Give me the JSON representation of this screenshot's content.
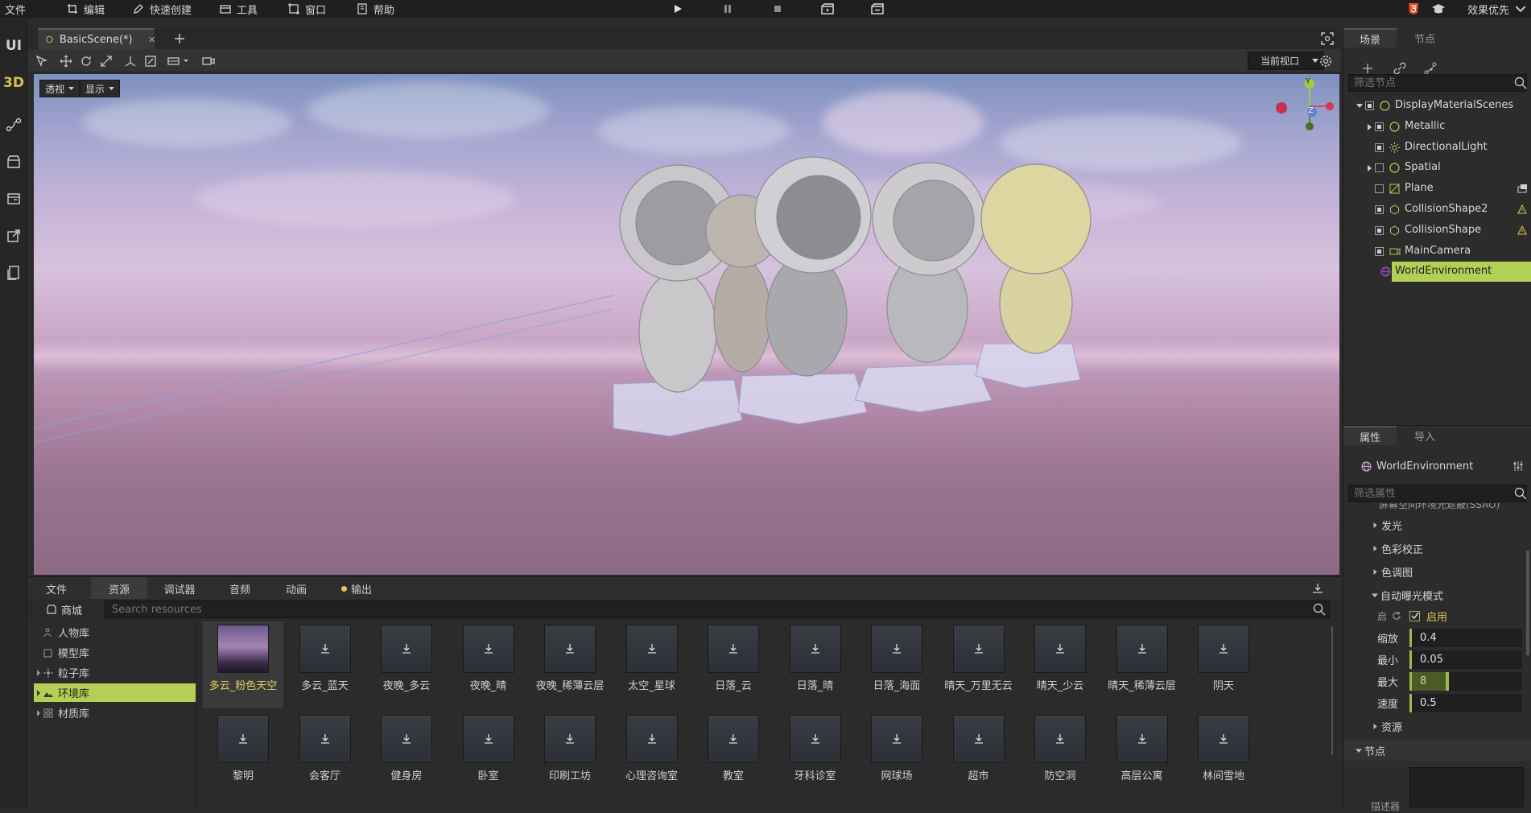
{
  "menu": {
    "file": "文件",
    "edit": "编辑",
    "quick_create": "快速创建",
    "tools": "工具",
    "window": "窗口",
    "help": "帮助",
    "effect_priority": "效果优先"
  },
  "left_rail": {
    "ui": "UI",
    "threed": "3D"
  },
  "doc_tab": {
    "title": "BasicScene(*)"
  },
  "viewport": {
    "view_select": "当前视口",
    "perspective": "透视",
    "display": "显示",
    "gizmo": {
      "y": "Y",
      "z": "Z"
    }
  },
  "bottom": {
    "tabs": [
      "文件",
      "资源",
      "调试器",
      "音频",
      "动画",
      "输出"
    ],
    "store": "商城",
    "search_placeholder": "Search resources",
    "tree": [
      {
        "label": "人物库"
      },
      {
        "label": "模型库"
      },
      {
        "label": "粒子库"
      },
      {
        "label": "环境库"
      },
      {
        "label": "材质库"
      }
    ],
    "row1": [
      "多云_粉色天空",
      "多云_蓝天",
      "夜晚_多云",
      "夜晚_晴",
      "夜晚_稀薄云层",
      "太空_星球",
      "日落_云",
      "日落_晴",
      "日落_海面",
      "晴天_万里无云",
      "晴天_少云",
      "晴天_稀薄云层",
      "阴天"
    ],
    "row2": [
      "黎明",
      "会客厅",
      "健身房",
      "卧室",
      "印刷工坊",
      "心理咨询室",
      "教室",
      "牙科诊室",
      "网球场",
      "超市",
      "防空洞",
      "高层公寓",
      "林间雪地"
    ]
  },
  "scene_panel": {
    "tabs": [
      "场景",
      "节点"
    ],
    "filter_placeholder": "筛选节点",
    "nodes": [
      {
        "label": "DisplayMaterialScenes"
      },
      {
        "label": "Metallic"
      },
      {
        "label": "DirectionalLight"
      },
      {
        "label": "Spatial"
      },
      {
        "label": "Plane"
      },
      {
        "label": "CollisionShape2"
      },
      {
        "label": "CollisionShape"
      },
      {
        "label": "MainCamera"
      },
      {
        "label": "WorldEnvironment"
      }
    ]
  },
  "props_panel": {
    "tabs": [
      "属性",
      "导入"
    ],
    "node_name": "WorldEnvironment",
    "filter_placeholder": "筛选属性",
    "cut_row": "屏幕空间环境光遮蔽(SSAO)",
    "sections": [
      "发光",
      "色彩校正",
      "色调图",
      "自动曝光模式"
    ],
    "enable_prefix": "启",
    "enable_label": "启用",
    "fields": [
      {
        "label": "缩放",
        "value": "0.4"
      },
      {
        "label": "最小",
        "value": "0.05"
      },
      {
        "label": "最大",
        "value": "8"
      },
      {
        "label": "速度",
        "value": "0.5"
      }
    ],
    "resource": "资源",
    "node_section": "节点",
    "bottom_label": "描述器"
  },
  "colors": {
    "accent": "#b8d45a",
    "accent_text": "#e0cf5a",
    "panel": "#2c2c2c",
    "menubar": "#1f1f1f",
    "selection": "#b4cf55"
  }
}
